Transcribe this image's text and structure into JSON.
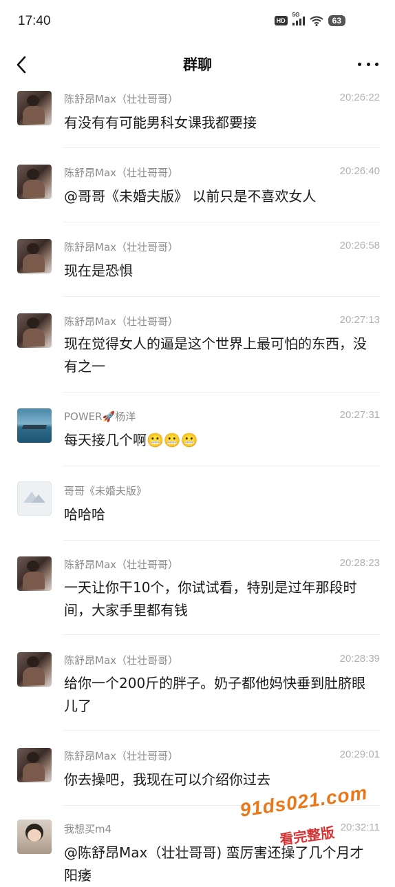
{
  "status_bar": {
    "time": "17:40",
    "network_badge": "HD",
    "network_type": "5G",
    "battery": "63"
  },
  "header": {
    "title": "群聊",
    "back_icon": "chevron-left-icon",
    "more_icon": "more-dots-icon"
  },
  "messages": [
    {
      "sender": "陈舒昂Max（壮壮哥哥）",
      "time": "20:26:22",
      "text": "有没有有可能男科女课我都要接",
      "avatar": "man-avatar"
    },
    {
      "sender": "陈舒昂Max（壮壮哥哥）",
      "time": "20:26:40",
      "text": "@哥哥《未婚夫版》 以前只是不喜欢女人",
      "avatar": "man-avatar"
    },
    {
      "sender": "陈舒昂Max（壮壮哥哥）",
      "time": "20:26:58",
      "text": "现在是恐惧",
      "avatar": "man-avatar"
    },
    {
      "sender": "陈舒昂Max（壮壮哥哥）",
      "time": "20:27:13",
      "text": "现在觉得女人的逼是这个世界上最可怕的东西，没有之一",
      "avatar": "man-avatar"
    },
    {
      "sender": "POWER🚀杨洋",
      "time": "20:27:31",
      "text": "每天接几个啊😬😬😬",
      "avatar": "boat-avatar"
    },
    {
      "sender": "哥哥《未婚夫版》",
      "time": "",
      "text": "哈哈哈",
      "avatar": "placeholder-avatar"
    },
    {
      "sender": "陈舒昂Max（壮壮哥哥）",
      "time": "20:28:23",
      "text": "一天让你干10个，你试试看，特别是过年那段时间，大家手里都有钱",
      "avatar": "man-avatar"
    },
    {
      "sender": "陈舒昂Max（壮壮哥哥）",
      "time": "20:28:39",
      "text": "给你一个200斤的胖子。奶子都他妈快垂到肚脐眼儿了",
      "avatar": "man-avatar"
    },
    {
      "sender": "陈舒昂Max（壮壮哥哥）",
      "time": "20:29:01",
      "text": "你去操吧，我现在可以介绍你过去",
      "avatar": "man-avatar"
    },
    {
      "sender": "我想买m4",
      "time": "20:32:11",
      "text": "@陈舒昂Max（壮壮哥哥) 蛮厉害还操了几个月才阳痿",
      "avatar": "kid-avatar"
    }
  ],
  "watermark": {
    "site": "91ds021.com",
    "caption": "看完整版"
  }
}
